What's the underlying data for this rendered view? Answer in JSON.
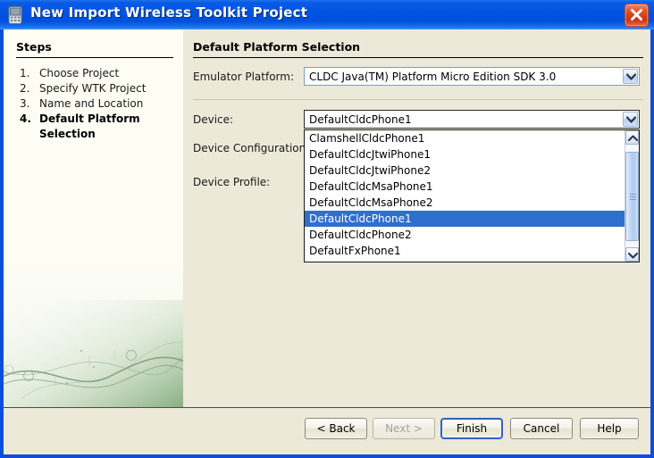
{
  "window": {
    "title": "New Import Wireless Toolkit Project",
    "icon": "mobile-device-icon",
    "close_label": "Close",
    "titlebar_color": "#0052e0",
    "frame_color": "#0b4fd8",
    "client_color": "#ece9d8"
  },
  "steps": {
    "heading": "Steps",
    "items": [
      {
        "num": "1.",
        "label": "Choose Project",
        "current": false
      },
      {
        "num": "2.",
        "label": "Specify WTK Project",
        "current": false
      },
      {
        "num": "3.",
        "label": "Name and Location",
        "current": false
      },
      {
        "num": "4.",
        "label": "Default Platform",
        "label_cont": "Selection",
        "current": true
      }
    ]
  },
  "content": {
    "title": "Default Platform Selection",
    "emulator_platform": {
      "label": "Emulator Platform:",
      "value": "CLDC Java(TM) Platform Micro Edition SDK 3.0"
    },
    "device": {
      "label": "Device:",
      "value": "DefaultCldcPhone1"
    },
    "device_configuration": {
      "label": "Device Configuration:",
      "value": ""
    },
    "device_profile": {
      "label": "Device Profile:",
      "value": ""
    }
  },
  "dropdown": {
    "open": true,
    "selected": "DefaultCldcPhone1",
    "selected_index": 5,
    "highlight_color": "#2f6fd0",
    "options": [
      "ClamshellCldcPhone1",
      "DefaultCldcJtwiPhone1",
      "DefaultCldcJtwiPhone2",
      "DefaultCldcMsaPhone1",
      "DefaultCldcMsaPhone2",
      "DefaultCldcPhone1",
      "DefaultCldcPhone2",
      "DefaultFxPhone1"
    ]
  },
  "buttons": [
    {
      "label": "< Back",
      "state": "enabled",
      "name": "back-button"
    },
    {
      "label": "Next >",
      "state": "disabled",
      "name": "next-button"
    },
    {
      "label": "Finish",
      "state": "default",
      "name": "finish-button"
    },
    {
      "label": "Cancel",
      "state": "enabled",
      "name": "cancel-button"
    },
    {
      "label": "Help",
      "state": "enabled",
      "name": "help-button"
    }
  ]
}
